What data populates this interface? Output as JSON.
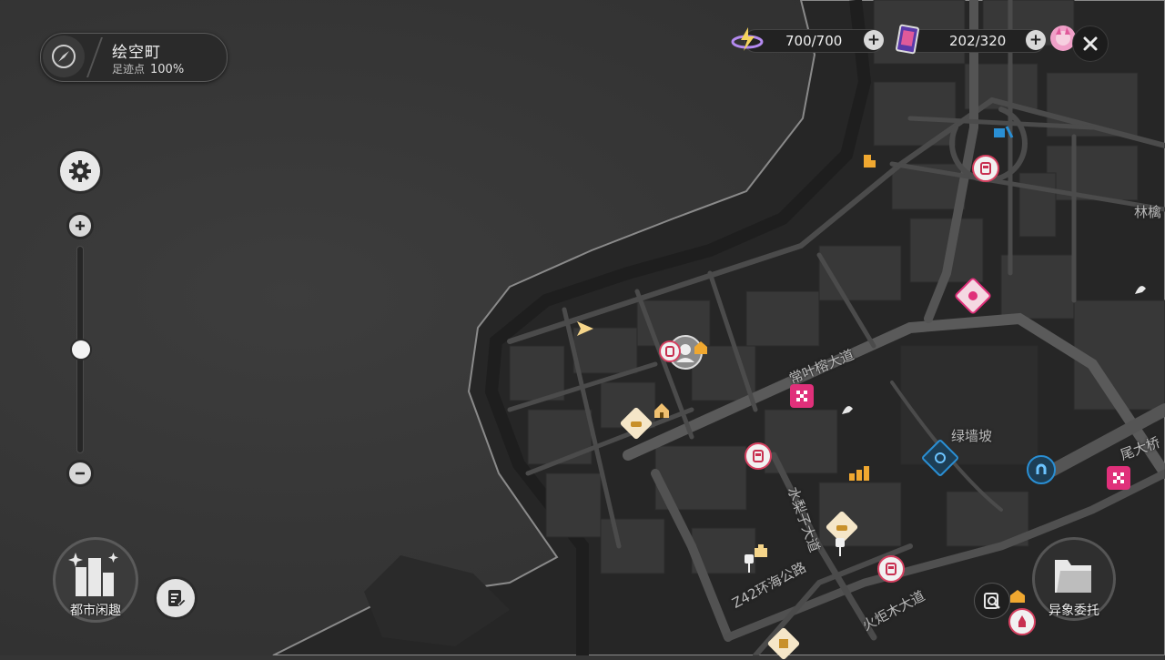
{
  "location": {
    "name": "绘空町",
    "progress_label": "足迹点",
    "progress_value": "100%",
    "icon": "compass-icon"
  },
  "resources": [
    {
      "name": "battery",
      "icon": "battery-charge-icon",
      "value": "700/700"
    },
    {
      "name": "film",
      "icon": "film-card-icon",
      "value": "202/320"
    }
  ],
  "map": {
    "labels": [
      {
        "id": "street-yeyerong",
        "text": "常叶榕大道"
      },
      {
        "id": "district-lvqiangpo",
        "text": "绿墙坡"
      },
      {
        "id": "street-shuilizi",
        "text": "水梨子大道"
      },
      {
        "id": "road-z42",
        "text": "Z42环海公路"
      },
      {
        "id": "street-huojumu",
        "text": "火炬木大道"
      },
      {
        "id": "bridge-east",
        "text": "尾大桥"
      },
      {
        "id": "district-linqiao",
        "text": "林檎"
      }
    ]
  },
  "buttons": {
    "city_fun": "都市闲趣",
    "commission": "异象委托"
  },
  "colors": {
    "background": "#353535",
    "land": "#262626",
    "road": "#4a4a4a",
    "block": "#3a3a3a",
    "accent_pink": "#e0307a",
    "accent_orange": "#f0a830",
    "accent_blue": "#2a8fd4"
  }
}
